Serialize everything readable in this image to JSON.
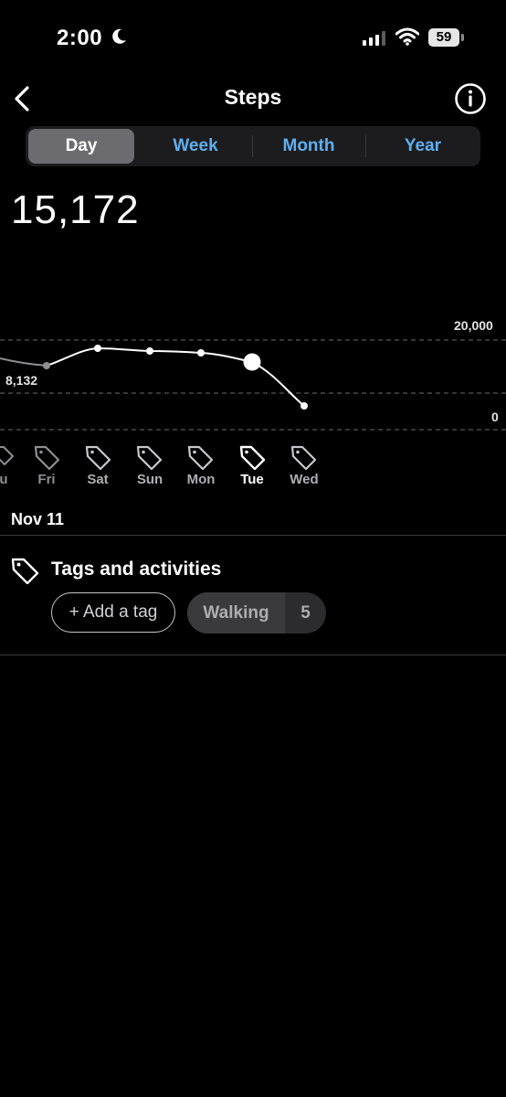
{
  "status_bar": {
    "time": "2:00",
    "battery": "59"
  },
  "header": {
    "title": "Steps"
  },
  "segments": [
    "Day",
    "Week",
    "Month",
    "Year"
  ],
  "selected_segment": "Day",
  "total_steps": "15,172",
  "chart": {
    "y_max_label": "20,000",
    "y_min_label": "0",
    "point_label": "8,132",
    "days": [
      "u",
      "Fri",
      "Sat",
      "Sun",
      "Mon",
      "Tue",
      "Wed"
    ],
    "selected_day": "Tue"
  },
  "date": "Nov 11",
  "tags": {
    "heading": "Tags and activities",
    "add_label": "+ Add a tag",
    "activity": "Walking",
    "activity_count": "5"
  }
}
